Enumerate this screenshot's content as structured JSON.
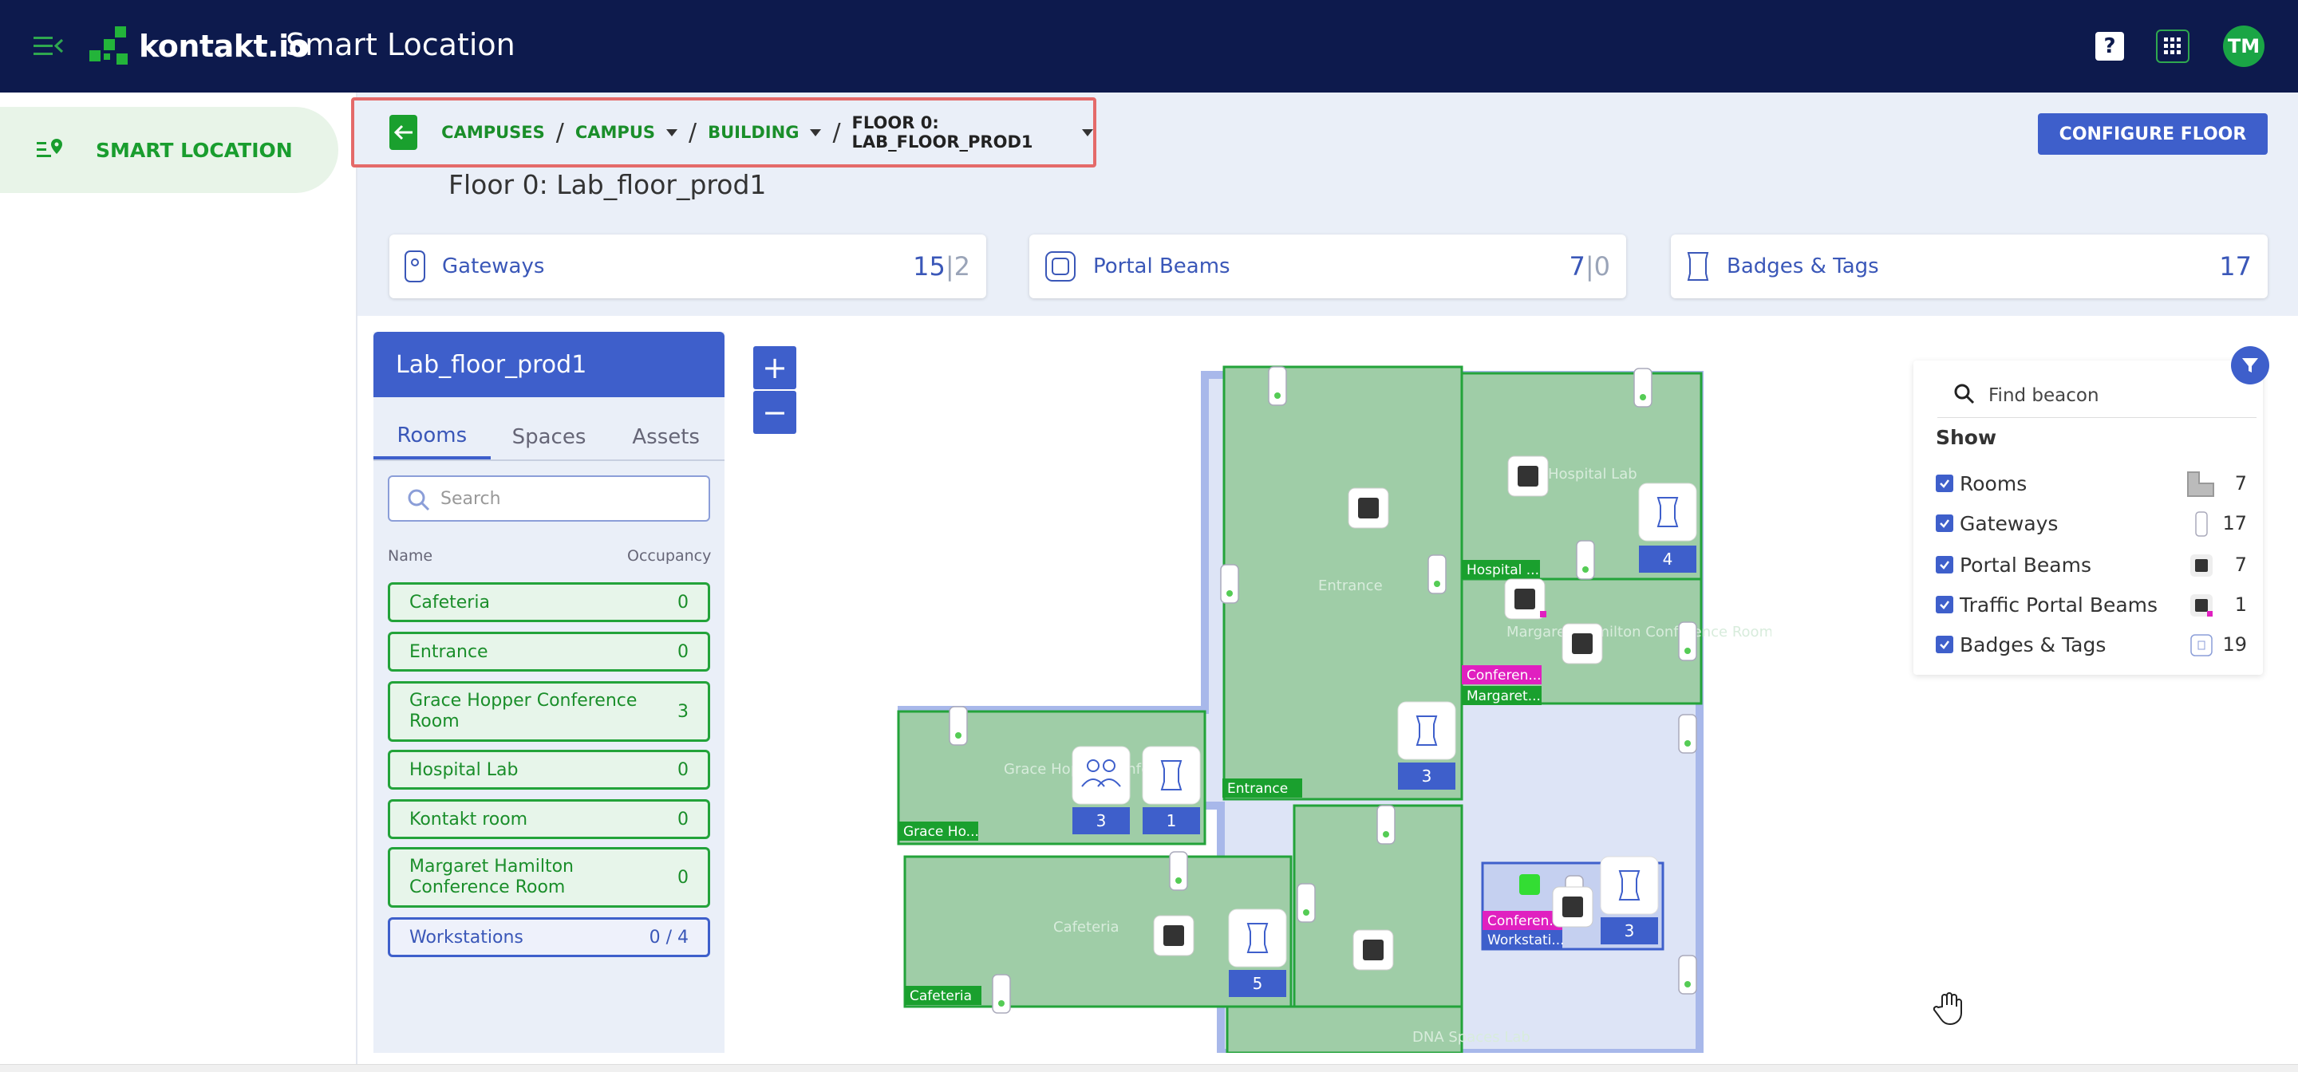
{
  "app": {
    "brand": "kontakt.io",
    "product": "Smart Location",
    "help": "?",
    "avatar": "TM"
  },
  "sidebar": {
    "items": [
      {
        "label": "SMART LOCATION",
        "icon": "location-pin-icon"
      }
    ]
  },
  "breadcrumb": {
    "items": [
      "CAMPUSES",
      "CAMPUS",
      "BUILDING"
    ],
    "current": "FLOOR 0: LAB_FLOOR_PROD1"
  },
  "floor": {
    "title": "Floor 0: Lab_floor_prod1",
    "configure": "CONFIGURE FLOOR",
    "panel_title": "Lab_floor_prod1"
  },
  "stats": [
    {
      "label": "Gateways",
      "online": "15",
      "sep": "|",
      "offline": "2"
    },
    {
      "label": "Portal Beams",
      "online": "7",
      "sep": "|",
      "offline": "0"
    },
    {
      "label": "Badges & Tags",
      "online": "17"
    }
  ],
  "tabs": [
    "Rooms",
    "Spaces",
    "Assets"
  ],
  "search": {
    "placeholder": "Search"
  },
  "columns": {
    "name": "Name",
    "occupancy": "Occupancy"
  },
  "rooms": [
    {
      "name": "Cafeteria",
      "occupancy": "0"
    },
    {
      "name": "Entrance",
      "occupancy": "0"
    },
    {
      "name": "Grace Hopper Conference Room",
      "occupancy": "3"
    },
    {
      "name": "Hospital Lab",
      "occupancy": "0"
    },
    {
      "name": "Kontakt room",
      "occupancy": "0"
    },
    {
      "name": "Margaret Hamilton Conference Room",
      "occupancy": "0"
    },
    {
      "name": "Workstations",
      "occupancy": "0 / 4"
    }
  ],
  "zoom": {
    "in": "+",
    "out": "−"
  },
  "map": {
    "room_labels": [
      "Hospital Lab",
      "Entrance",
      "Margaret Hamilton Conference Room",
      "Grace Hopper Conference",
      "Cafeteria",
      "DNA Spaces Lab"
    ],
    "tags": [
      "Hospital ...",
      "Conferen...",
      "Margaret...",
      "Entrance",
      "Grace Ho...",
      "Cafeteria",
      "Conferen...",
      "Workstati..."
    ],
    "counts": [
      "4",
      "3",
      "3",
      "1",
      "5",
      "3"
    ]
  },
  "legend": {
    "find_placeholder": "Find beacon",
    "show": "Show",
    "rows": [
      {
        "label": "Rooms",
        "count": "7"
      },
      {
        "label": "Gateways",
        "count": "17"
      },
      {
        "label": "Portal Beams",
        "count": "7"
      },
      {
        "label": "Traffic Portal Beams",
        "count": "1"
      },
      {
        "label": "Badges & Tags",
        "count": "19"
      }
    ]
  },
  "colors": {
    "navy": "#0d1a4d",
    "green": "#1aa02e",
    "blue": "#3e5fcb",
    "magenta": "#e020c0"
  }
}
